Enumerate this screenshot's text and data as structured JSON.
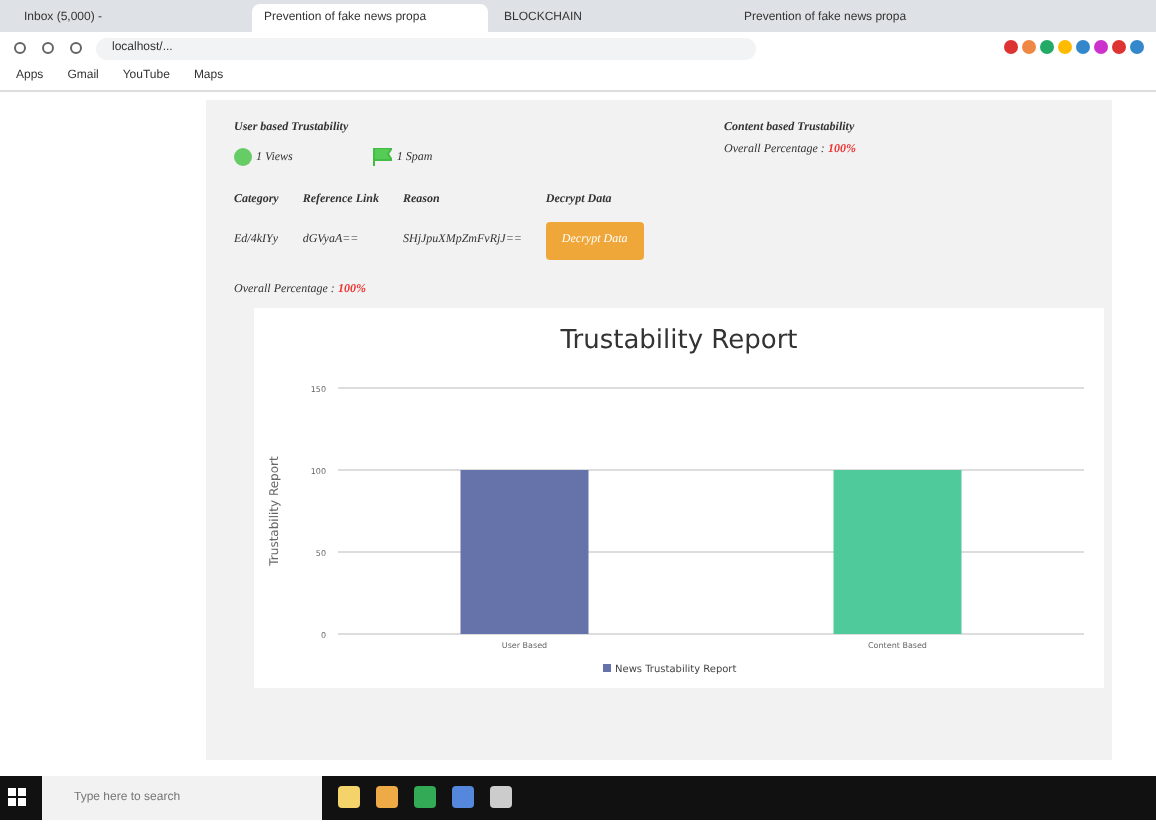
{
  "browser": {
    "tabs": [
      {
        "label": "Inbox (5,000) - ",
        "selected": false
      },
      {
        "label": "Prevention of fake news propa",
        "selected": true
      },
      {
        "label": "BLOCKCHAIN",
        "selected": false
      },
      {
        "label": "Prevention of fake news propa",
        "selected": false
      }
    ],
    "address": "localhost/...",
    "bookmarks": [
      "Apps",
      "Gmail",
      "YouTube",
      "Maps"
    ]
  },
  "user_based": {
    "title": "User based Trustability",
    "views": "1 Views",
    "spam": "1 Spam"
  },
  "content_based": {
    "title": "Content based Trustability",
    "percentage_label": "Overall Percentage :",
    "percentage": "100%"
  },
  "table": {
    "columns": [
      "Category",
      "Reference Link",
      "Reason",
      "Decrypt Data"
    ],
    "rows": [
      {
        "category": "Ed/4kIYy",
        "link": "dGVyaA==",
        "reason": "SHjJpuXMpZmFvRjJ==",
        "button": "Decrypt Data"
      }
    ]
  },
  "overall": {
    "label": "Overall Percentage :",
    "value": "100%"
  },
  "chart": {
    "chart_data": {
      "type": "bar",
      "title": "Trustability Report",
      "ylabel": "Trustability Report",
      "categories": [
        "User Based",
        "Content Based"
      ],
      "series": [
        {
          "name": "News Trustability Report",
          "color": "#6673aa",
          "values": [
            100,
            null
          ]
        },
        {
          "color": "#4fcb9b",
          "values": [
            null,
            100
          ]
        }
      ],
      "stacked": true,
      "ylim": [
        0,
        150
      ],
      "yticks": [
        0,
        50,
        100,
        150
      ]
    }
  },
  "taskbar": {
    "search_placeholder": "Type here to search"
  }
}
